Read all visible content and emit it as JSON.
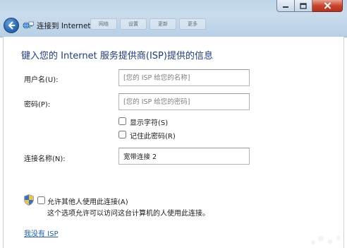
{
  "window": {
    "title": "连接到 Internet",
    "background_tabs": [
      "网络",
      "设置",
      "更新",
      "更多"
    ]
  },
  "heading": "键入您的 Internet 服务提供商(ISP)提供的信息",
  "form": {
    "username": {
      "label": "用户名(U):",
      "value": "",
      "placeholder": "[您的 ISP 给您的名称]"
    },
    "password": {
      "label": "密码(P):",
      "value": "",
      "placeholder": "[您的 ISP 给您的密码]"
    },
    "show_chars": {
      "label": "显示字符(S)",
      "checked": false
    },
    "remember_password": {
      "label": "记住此密码(R)",
      "checked": false
    },
    "connection_name": {
      "label": "连接名称(N):",
      "value": "宽带连接 2"
    }
  },
  "allow_others": {
    "label": "允许其他人使用此连接(A)",
    "checked": false,
    "note": "这个选项允许可以访问这台计算机的人使用此连接。"
  },
  "no_isp_link": "我没有 ISP",
  "icons": {
    "back": "back-arrow-icon",
    "window": "network-connection-icon",
    "shield": "uac-shield-icon",
    "minimize": "minimize-icon",
    "maximize": "maximize-icon",
    "close": "close-icon"
  },
  "colors": {
    "heading": "#1e3b8a",
    "link": "#1f5fb4",
    "close_button": "#c9442d"
  }
}
